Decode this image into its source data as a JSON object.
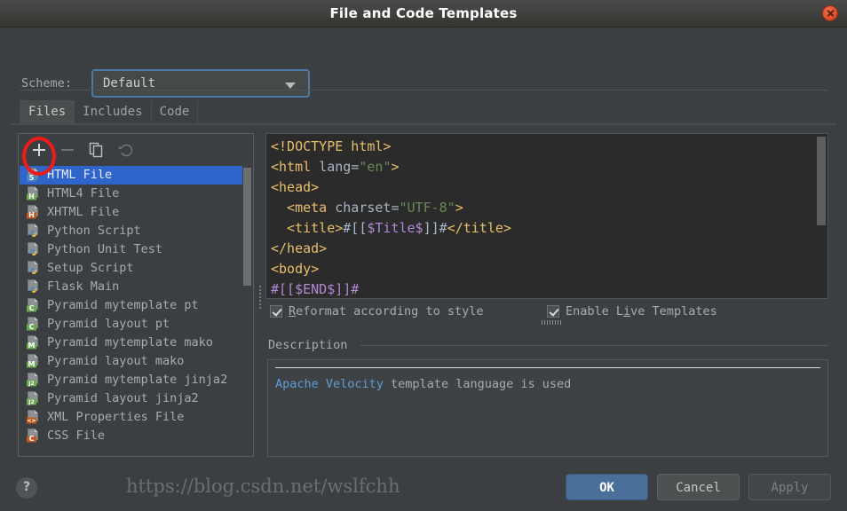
{
  "window": {
    "title": "File and Code Templates",
    "close_icon": "close-icon"
  },
  "scheme": {
    "label": "Scheme:",
    "value": "Default",
    "arrow_icon": "chevron-down-icon"
  },
  "tabs": [
    {
      "label": "Files",
      "active": true
    },
    {
      "label": "Includes",
      "active": false
    },
    {
      "label": "Code",
      "active": false
    }
  ],
  "list_toolbar": [
    {
      "name": "add-template-button",
      "icon": "plus-icon",
      "enabled": true
    },
    {
      "name": "remove-template-button",
      "icon": "minus-icon",
      "enabled": false
    },
    {
      "name": "copy-template-button",
      "icon": "copy-icon",
      "enabled": true
    },
    {
      "name": "reset-template-button",
      "icon": "undo-icon",
      "enabled": false
    }
  ],
  "templates": [
    {
      "label": "HTML File",
      "icon": "html5-file-icon",
      "selected": true
    },
    {
      "label": "HTML4 File",
      "icon": "html4-file-icon",
      "selected": false
    },
    {
      "label": "XHTML File",
      "icon": "xhtml-file-icon",
      "selected": false
    },
    {
      "label": "Python Script",
      "icon": "python-file-icon",
      "selected": false
    },
    {
      "label": "Python Unit Test",
      "icon": "python-file-icon",
      "selected": false
    },
    {
      "label": "Setup Script",
      "icon": "python-file-icon",
      "selected": false
    },
    {
      "label": "Flask Main",
      "icon": "python-file-icon",
      "selected": false
    },
    {
      "label": "Pyramid mytemplate pt",
      "icon": "chameleon-file-icon",
      "selected": false
    },
    {
      "label": "Pyramid layout pt",
      "icon": "chameleon-file-icon",
      "selected": false
    },
    {
      "label": "Pyramid mytemplate mako",
      "icon": "mako-file-icon",
      "selected": false
    },
    {
      "label": "Pyramid layout mako",
      "icon": "mako-file-icon",
      "selected": false
    },
    {
      "label": "Pyramid mytemplate jinja2",
      "icon": "jinja2-file-icon",
      "selected": false
    },
    {
      "label": "Pyramid layout jinja2",
      "icon": "jinja2-file-icon",
      "selected": false
    },
    {
      "label": "XML Properties File",
      "icon": "xml-file-icon",
      "selected": false
    },
    {
      "label": "CSS File",
      "icon": "css-file-icon",
      "selected": false
    }
  ],
  "editor": {
    "lines": [
      [
        {
          "t": "<!DOCTYPE html>",
          "c": "c-tag"
        }
      ],
      [
        {
          "t": "<html ",
          "c": "c-tag"
        },
        {
          "t": "lang=",
          "c": "c-attr"
        },
        {
          "t": "\"en\"",
          "c": "c-str"
        },
        {
          "t": ">",
          "c": "c-tag"
        }
      ],
      [
        {
          "t": "<head>",
          "c": "c-tag"
        }
      ],
      [
        {
          "t": "  <meta ",
          "c": "c-tag"
        },
        {
          "t": "charset=",
          "c": "c-attr"
        },
        {
          "t": "\"UTF-8\"",
          "c": "c-str"
        },
        {
          "t": ">",
          "c": "c-tag"
        }
      ],
      [
        {
          "t": "  <title>",
          "c": "c-tag"
        },
        {
          "t": "#[[",
          "c": "c-txt"
        },
        {
          "t": "$Title$",
          "c": "c-var"
        },
        {
          "t": "]]#",
          "c": "c-txt"
        },
        {
          "t": "</title>",
          "c": "c-tag"
        }
      ],
      [
        {
          "t": "</head>",
          "c": "c-tag"
        }
      ],
      [
        {
          "t": "<body>",
          "c": "c-tag"
        }
      ],
      [
        {
          "t": "#[[$END$]]#",
          "c": "c-var"
        }
      ]
    ]
  },
  "options": {
    "reformat": {
      "label_pre": "",
      "label": "Reformat according to style",
      "underline": "R",
      "checked": true
    },
    "live_templates": {
      "label": "Enable Live Templates",
      "underline": "i",
      "checked": true
    }
  },
  "description": {
    "title": "Description",
    "link_text": "Apache Velocity",
    "rest_text": " template language is used"
  },
  "buttons": {
    "help": "?",
    "ok": "OK",
    "cancel": "Cancel",
    "apply": "Apply"
  },
  "annotations": {
    "watermark": "https://blog.csdn.net/wslfchh"
  },
  "colors": {
    "accent_blue": "#2f65ca",
    "ok_button": "#4a6f99",
    "annotation_red": "#ee1b1b",
    "editor_bg": "#2b2b2b",
    "dialog_bg": "#3c3f41"
  }
}
